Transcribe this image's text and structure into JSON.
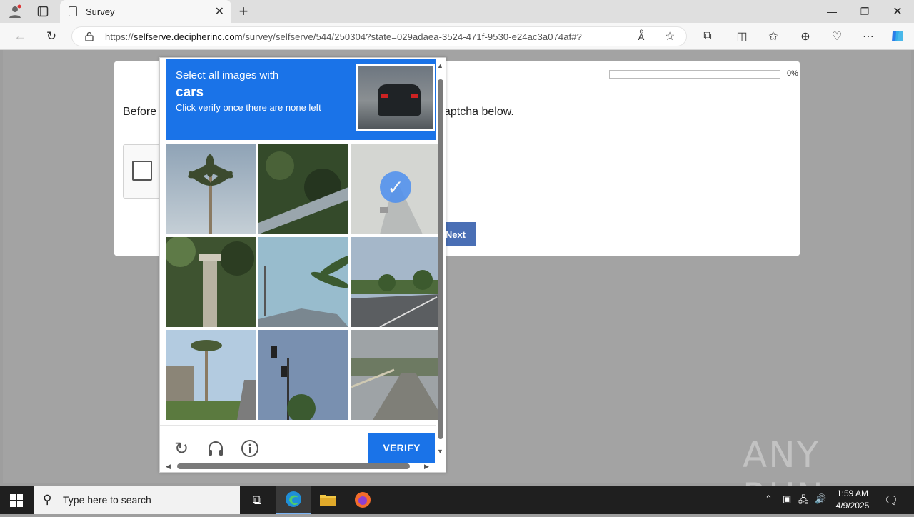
{
  "browser": {
    "tab_title": "Survey",
    "url_prefix": "https://",
    "url_domain": "selfserve.decipherinc.com",
    "url_path": "/survey/selfserve/544/250304?state=029adaea-3524-471f-9530-e24ac3a074af#?"
  },
  "survey": {
    "progress_percent": 0,
    "progress_label": "0%",
    "question_left": "Before",
    "question_right": "aptcha below.",
    "next_label": "Next"
  },
  "captcha": {
    "prompt_line1": "Select all images with",
    "prompt_target": "cars",
    "prompt_line3": "Click verify once there are none left",
    "verify_label": "VERIFY",
    "selected_tile_index": 2,
    "tiles": [
      "palm-tree",
      "bushes-wall",
      "highway-car",
      "lamp-post",
      "palm-roof",
      "road-trees",
      "palms-street",
      "traffic-light",
      "road-fence"
    ]
  },
  "watermark": "ANY RUN",
  "taskbar": {
    "search_placeholder": "Type here to search",
    "time": "1:59 AM",
    "date": "4/9/2025"
  },
  "colors": {
    "captcha_blue": "#1a73e8",
    "next_button": "#4a6fb5"
  }
}
